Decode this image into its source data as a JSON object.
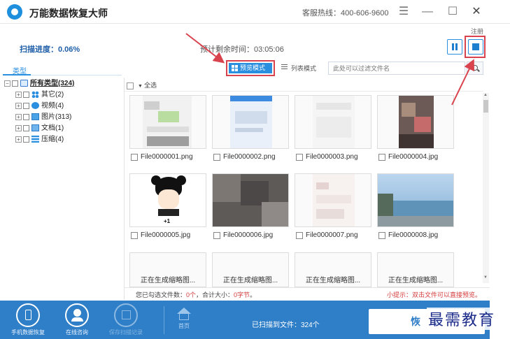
{
  "window": {
    "title": "万能数据恢复大师",
    "hotline": "客服热线：400-606-9600",
    "register": "注册"
  },
  "progress": {
    "scan_label": "扫描进度：0.06%",
    "remaining_label": "预计剩余时间：03:05:06"
  },
  "sidebar": {
    "tab_label": "类型",
    "tree": {
      "root": "所有类型(324)",
      "items": [
        {
          "label": "其它(2)",
          "icon": "other-icon"
        },
        {
          "label": "视频(4)",
          "icon": "video-icon"
        },
        {
          "label": "图片(313)",
          "icon": "image-icon"
        },
        {
          "label": "文档(1)",
          "icon": "document-icon"
        },
        {
          "label": "压缩(4)",
          "icon": "archive-icon"
        }
      ]
    }
  },
  "toolbar": {
    "preview_mode": "预览模式",
    "list_mode": "列表模式",
    "filter_placeholder": "此处可以过滤文件名"
  },
  "content": {
    "select_all": "全选",
    "files": [
      "File0000001.png",
      "File0000002.png",
      "File0000003.png",
      "File0000004.jpg",
      "File0000005.jpg",
      "File0000006.jpg",
      "File0000007.png",
      "File0000008.jpg"
    ],
    "generating": [
      "正在生成缩略图...",
      "正在生成缩略图...",
      "正在生成缩略图...",
      "正在生成缩略图..."
    ]
  },
  "status": {
    "prefix": "您已勾选文件数：",
    "count": "0个",
    "mid": "，合计大小：",
    "size": "0字节",
    "suffix": "。",
    "tip": "小提示：双击文件可以直接预览。"
  },
  "footer": {
    "phone_recovery": "手机数据恢复",
    "online_consult": "在线咨询",
    "save_record": "保存扫描记录",
    "home": "首页",
    "scanned": "已扫描到文件：324个",
    "recover": "恢复"
  },
  "watermark": "最需教育",
  "colors": {
    "accent": "#2b8fe0",
    "footer_bg": "#2f7fc8",
    "annotation_red": "#d9434d",
    "warning_text": "#d43a3a"
  }
}
